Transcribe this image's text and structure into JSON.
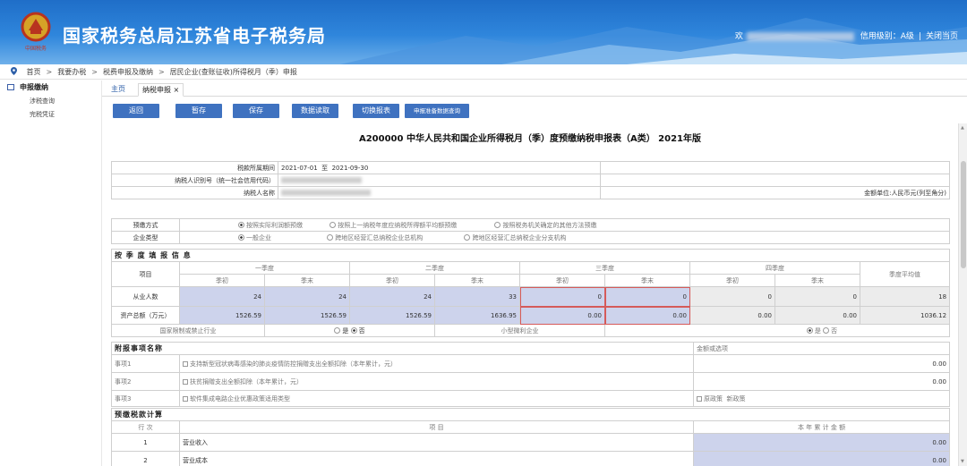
{
  "header": {
    "site_title": "国家税务总局江苏省电子税务局",
    "welcome": "欢",
    "credit_level": "信用级别：A级",
    "close_page": "关闭当页",
    "logo_caption": "中国税务"
  },
  "breadcrumb": [
    "首页",
    "我要办税",
    "税费申报及缴纳",
    "居民企业(查账征收)所得税月（季）申报"
  ],
  "sidebar": {
    "title": "申报缴纳",
    "items": [
      "涉税查询",
      "完税凭证"
    ]
  },
  "tabs": [
    {
      "label": "主页"
    },
    {
      "label": "纳税申报 ×"
    }
  ],
  "toolbar": [
    "返回",
    "暂存",
    "保存",
    "数据读取",
    "切换报表",
    "申报准备数据查询"
  ],
  "form": {
    "title": "A200000 中华人民共和国企业所得税月（季）度预缴纳税申报表（A类） 2021年版",
    "period_label": "税款所属期间",
    "period_from": "2021-07-01",
    "period_to_label": "至",
    "period_to": "2021-09-30",
    "taxpayer_id_label": "纳税人识别号（统一社会信用代码）",
    "taxpayer_name_label": "纳税人名称",
    "amount_unit": "金额单位:人民币元(列至角分)",
    "prepay_method_label": "预缴方式",
    "prepay_options": [
      "按照实际利润额预缴",
      "按照上一纳税年度应纳税所得额平均额预缴",
      "按照税务机关确定的其他方法预缴"
    ],
    "enterprise_type_label": "企业类型",
    "enterprise_options": [
      "一般企业",
      "跨地区经营汇总纳税企业总机构",
      "跨地区经营汇总纳税企业分支机构"
    ],
    "section_quarter": "按 季 度 填 报 信 息",
    "item_col": "项目",
    "quarters": [
      "一季度",
      "二季度",
      "三季度",
      "四季度"
    ],
    "qstart": "季初",
    "qend": "季末",
    "avg_col": "季度平均值",
    "rows": [
      {
        "label": "从业人数",
        "values": [
          "24",
          "24",
          "24",
          "33",
          "0",
          "0",
          "0",
          "0"
        ],
        "avg": "18"
      },
      {
        "label": "资产总额（万元）",
        "values": [
          "1526.59",
          "1526.59",
          "1526.59",
          "1636.95",
          "0.00",
          "0.00",
          "0.00",
          "0.00"
        ],
        "avg": "1036.12"
      }
    ],
    "restricted_label": "国家限制或禁止行业",
    "yes": "是",
    "no": "否",
    "small_label": "小型微利企业",
    "section_attached": "附报事项名称",
    "amount_or_option": "金额或选项",
    "attached": [
      {
        "name": "事项1",
        "desc": "支持新型冠状病毒感染的肺炎疫情防控捐赠支出全额扣除（本年累计，元）",
        "value": "0.00"
      },
      {
        "name": "事项2",
        "desc": "扶贫捐赠支出全额扣除（本年累计，元）",
        "value": "0.00"
      },
      {
        "name": "事项3",
        "desc": "软件集成电路企业优惠政策适用类型",
        "opt1": "原政策",
        "opt2": "新政策"
      }
    ],
    "section_calc": "预缴税款计算",
    "calc_row_col": "行 次",
    "calc_item_col": "项 目",
    "calc_amount_col": "本 年 累 计 金 额",
    "calc_rows": [
      {
        "no": "1",
        "item": "营业收入",
        "amount": "0.00"
      },
      {
        "no": "2",
        "item": "营业成本",
        "amount": "0.00"
      }
    ]
  }
}
